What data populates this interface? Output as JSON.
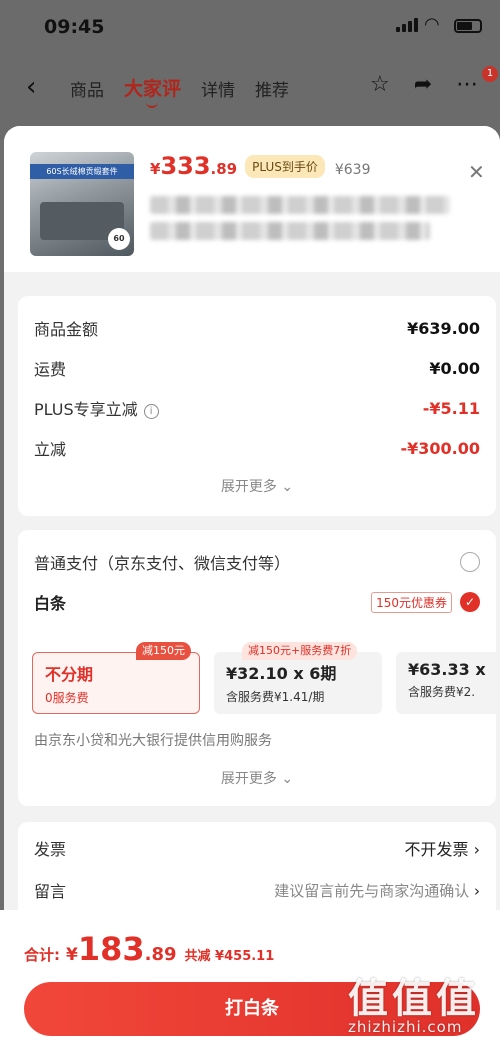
{
  "status": {
    "time": "09:45"
  },
  "nav": {
    "back": "‹",
    "tabs": [
      "商品",
      "大家评",
      "详情",
      "推荐"
    ],
    "active_tab": "大家评",
    "badge": "1"
  },
  "product": {
    "thumb_text": "60S长绒棉贡缎套件",
    "thumb_badge": "60",
    "currency": "¥",
    "price_int": "333",
    "price_dec": ".89",
    "plus_tag": "PLUS到手价",
    "original_price": "¥639"
  },
  "summary": {
    "rows": [
      {
        "label": "商品金额",
        "value": "¥639.00"
      },
      {
        "label": "运费",
        "value": "¥0.00"
      },
      {
        "label": "PLUS专享立减",
        "value": "-¥5.11"
      },
      {
        "label": "立减",
        "value": "-¥300.00"
      }
    ],
    "expand": "展开更多 ⌄"
  },
  "payment": {
    "normal_label": "普通支付（京东支付、微信支付等）",
    "baitiao_label": "白条",
    "coupon": "150元优惠券",
    "plans": [
      {
        "tag": "减150元",
        "title": "不分期",
        "sub": "0服务费"
      },
      {
        "tag": "减150元+服务费7折",
        "title": "¥32.10 x 6期",
        "sub": "含服务费¥1.41/期"
      },
      {
        "tag": "",
        "title": "¥63.33 x",
        "sub": "含服务费¥2."
      }
    ],
    "provider": "由京东小贷和光大银行提供信用购服务",
    "expand": "展开更多 ⌄"
  },
  "extras": {
    "invoice_label": "发票",
    "invoice_value": "不开发票",
    "message_label": "留言",
    "message_placeholder": "建议留言前先与商家沟通确认"
  },
  "footer": {
    "total_label": "合计:",
    "currency": "¥",
    "total_int": "183",
    "total_dec": ".89",
    "save": "共减 ¥455.11",
    "button": "打白条"
  },
  "watermark": {
    "line1": "值值值",
    "line2": "zhizhizhi.com"
  },
  "colors": {
    "accent": "#e03028",
    "plus_tag_bg": "#fbe7b8"
  }
}
